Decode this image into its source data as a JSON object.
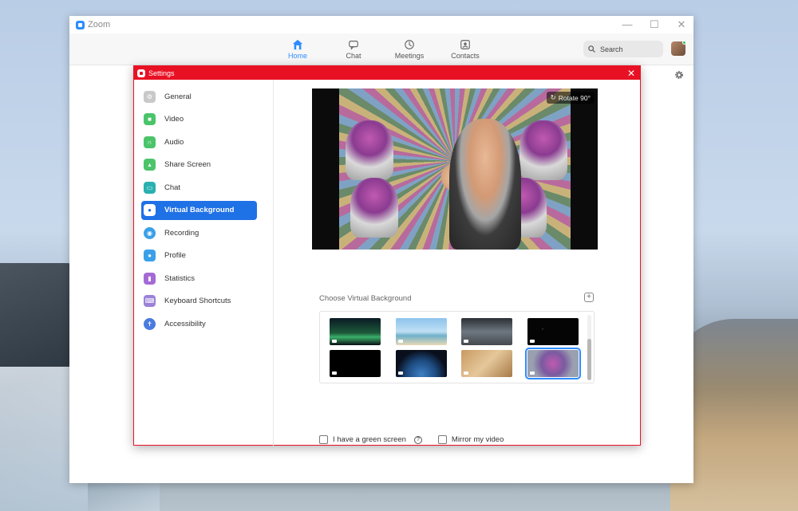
{
  "colors": {
    "accent": "#2d8cff",
    "settings_titlebar": "#e81123",
    "sidebar_active": "#1f71e6"
  },
  "window": {
    "title": "Zoom",
    "minimize": "—",
    "maximize": "☐",
    "close": "✕"
  },
  "nav": {
    "items": [
      {
        "label": "Home",
        "icon": "home-icon"
      },
      {
        "label": "Chat",
        "icon": "chat-icon"
      },
      {
        "label": "Meetings",
        "icon": "clock-icon"
      },
      {
        "label": "Contacts",
        "icon": "contacts-icon"
      }
    ],
    "search_label": "Search"
  },
  "settings": {
    "title": "Settings",
    "close": "✕",
    "sidebar": [
      {
        "label": "General",
        "icon": "gear-icon",
        "color": "#c9c9c9"
      },
      {
        "label": "Video",
        "icon": "video-icon",
        "color": "#4bc46a"
      },
      {
        "label": "Audio",
        "icon": "headphones-icon",
        "color": "#4bc46a"
      },
      {
        "label": "Share Screen",
        "icon": "share-screen-icon",
        "color": "#4bc46a"
      },
      {
        "label": "Chat",
        "icon": "chat-icon",
        "color": "#2ab0b0"
      },
      {
        "label": "Virtual Background",
        "icon": "person-background-icon",
        "color": "#ffffff"
      },
      {
        "label": "Recording",
        "icon": "record-icon",
        "color": "#3aa0e8"
      },
      {
        "label": "Profile",
        "icon": "profile-icon",
        "color": "#3aa0e8"
      },
      {
        "label": "Statistics",
        "icon": "bar-chart-icon",
        "color": "#a46ad6"
      },
      {
        "label": "Keyboard Shortcuts",
        "icon": "keyboard-icon",
        "color": "#9b82d8"
      },
      {
        "label": "Accessibility",
        "icon": "accessibility-icon",
        "color": "#4a7be0"
      }
    ],
    "rotate_label": "Rotate 90°",
    "choose_label": "Choose Virtual Background",
    "add_symbol": "+",
    "thumbnails": [
      {
        "name": "aurora",
        "selected": false
      },
      {
        "name": "beach",
        "selected": false
      },
      {
        "name": "room",
        "selected": false
      },
      {
        "name": "space",
        "selected": false
      },
      {
        "name": "black",
        "selected": false
      },
      {
        "name": "earth",
        "selected": false
      },
      {
        "name": "dogs",
        "selected": false
      },
      {
        "name": "creatures",
        "selected": true
      }
    ],
    "green_screen_label": "I have a green screen",
    "mirror_label": "Mirror my video",
    "help_symbol": "?"
  }
}
